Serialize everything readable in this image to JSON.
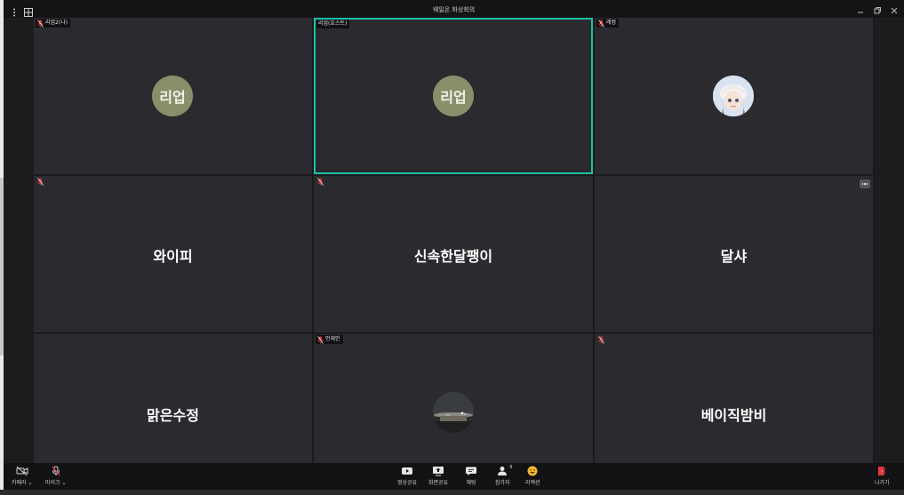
{
  "window": {
    "title": "웨일온 화상회의"
  },
  "tiles": [
    {
      "label": "리업2(나)",
      "avatar_text": "리업"
    },
    {
      "label": "리업(호스트)",
      "avatar_text": "리업"
    },
    {
      "label": "레정"
    },
    {
      "name": "와이피"
    },
    {
      "name": "신속한달팽이"
    },
    {
      "name": "달샤"
    },
    {
      "name": "맑은수정"
    },
    {
      "label": "언재인"
    },
    {
      "name": "베이직밤비"
    }
  ],
  "toolbar": {
    "camera": "카메라",
    "mic": "마이크",
    "video_share": "영상공유",
    "screen_share": "화면공유",
    "chat": "채팅",
    "participants": "참가자",
    "participants_count": "9",
    "reaction": "리액션",
    "leave": "나가기"
  },
  "colors": {
    "active_border": "#19c3a5",
    "avatar_bg": "#8a8f6b",
    "tile_bg": "#2b2a2f",
    "leave_red": "#e0393e"
  }
}
